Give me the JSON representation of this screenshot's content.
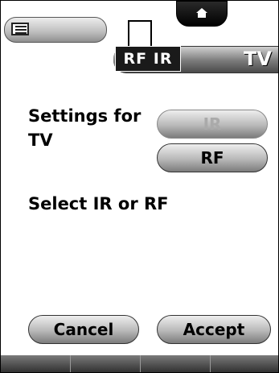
{
  "header": {
    "menu_icon": "list-icon",
    "home_icon": "home-icon",
    "device_icon": "device-icon",
    "mode_badge": "RF IR",
    "title": "TV"
  },
  "main": {
    "settings_label": "Settings for TV",
    "select_label": "Select IR or RF",
    "ir_button": "IR",
    "rf_button": "RF"
  },
  "footer": {
    "cancel_label": "Cancel",
    "accept_label": "Accept",
    "tab_count": 4
  }
}
